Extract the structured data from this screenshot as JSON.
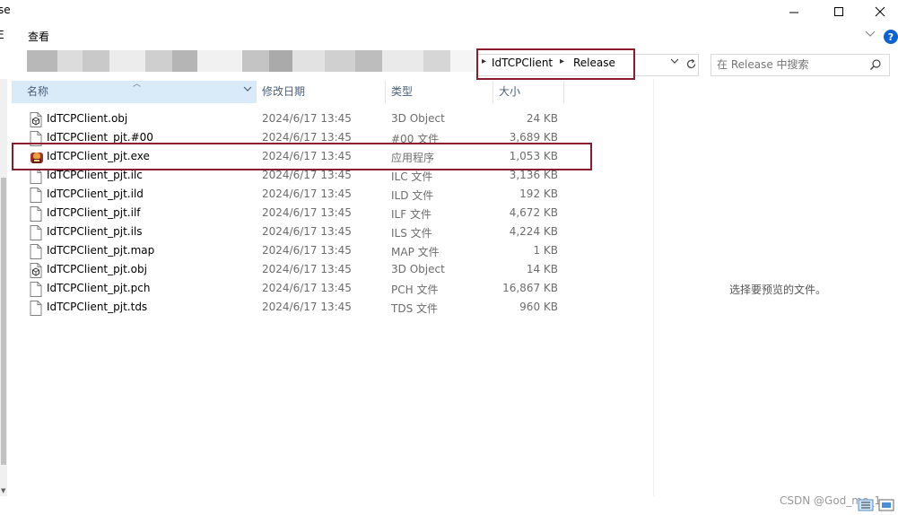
{
  "window": {
    "title_fragment": "se",
    "minimize_glyph": "—",
    "maximize_glyph": "☐",
    "close_glyph": "✕"
  },
  "ribbon": {
    "left_fragment": "Ε",
    "view_tab": "查看"
  },
  "address": {
    "crumbs": [
      "IdTCPClient",
      "Release"
    ]
  },
  "search": {
    "placeholder": "在 Release 中搜索"
  },
  "columns": {
    "name": "名称",
    "date": "修改日期",
    "type": "类型",
    "size": "大小"
  },
  "files": [
    {
      "name": "IdTCPClient.obj",
      "date": "2024/6/17 13:45",
      "type": "3D Object",
      "size": "24 KB",
      "icon": "obj-file-icon"
    },
    {
      "name": "IdTCPClient_pjt.#00",
      "date": "2024/6/17 13:45",
      "type": "#00 文件",
      "size": "3,689 KB",
      "icon": "blank-file-icon"
    },
    {
      "name": "IdTCPClient_pjt.exe",
      "date": "2024/6/17 13:45",
      "type": "应用程序",
      "size": "1,053 KB",
      "icon": "exe-app-icon"
    },
    {
      "name": "IdTCPClient_pjt.ilc",
      "date": "2024/6/17 13:45",
      "type": "ILC 文件",
      "size": "3,136 KB",
      "icon": "blank-file-icon"
    },
    {
      "name": "IdTCPClient_pjt.ild",
      "date": "2024/6/17 13:45",
      "type": "ILD 文件",
      "size": "192 KB",
      "icon": "blank-file-icon"
    },
    {
      "name": "IdTCPClient_pjt.ilf",
      "date": "2024/6/17 13:45",
      "type": "ILF 文件",
      "size": "4,672 KB",
      "icon": "blank-file-icon"
    },
    {
      "name": "IdTCPClient_pjt.ils",
      "date": "2024/6/17 13:45",
      "type": "ILS 文件",
      "size": "4,224 KB",
      "icon": "blank-file-icon"
    },
    {
      "name": "IdTCPClient_pjt.map",
      "date": "2024/6/17 13:45",
      "type": "MAP 文件",
      "size": "1 KB",
      "icon": "blank-file-icon"
    },
    {
      "name": "IdTCPClient_pjt.obj",
      "date": "2024/6/17 13:45",
      "type": "3D Object",
      "size": "14 KB",
      "icon": "obj-file-icon"
    },
    {
      "name": "IdTCPClient_pjt.pch",
      "date": "2024/6/17 13:45",
      "type": "PCH 文件",
      "size": "16,867 KB",
      "icon": "blank-file-icon"
    },
    {
      "name": "IdTCPClient_pjt.tds",
      "date": "2024/6/17 13:45",
      "type": "TDS 文件",
      "size": "960 KB",
      "icon": "blank-file-icon"
    }
  ],
  "preview": {
    "message": "选择要预览的文件。"
  },
  "watermark": "CSDN @God_me_1",
  "colors": {
    "highlight_box": "#8b1c2e",
    "sorted_header": "#d9ebf9",
    "help_button": "#0a63d1"
  }
}
